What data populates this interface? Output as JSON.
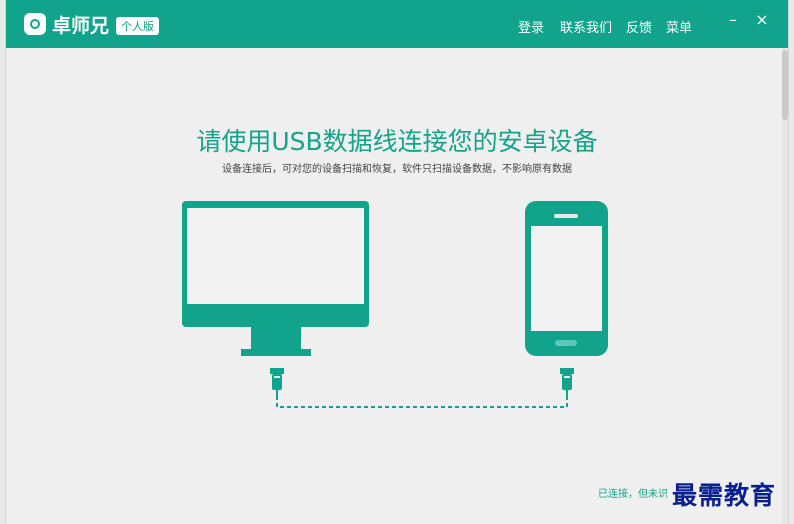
{
  "window": {
    "title": "卓师兄",
    "edition": "个人版",
    "menu": {
      "login": "登录",
      "contact": "联系我们",
      "feedback": "反馈",
      "menu": "菜单"
    },
    "controls": {
      "minimize": "–",
      "close": "×"
    }
  },
  "main": {
    "heading": "请使用USB数据线连接您的安卓设备",
    "subheading": "设备连接后，可对您的设备扫描和恢复，软件只扫描设备数据，不影响原有数据"
  },
  "status": {
    "text": "已连接，但未识"
  },
  "watermark": {
    "text": "最需教育"
  },
  "colors": {
    "accent": "#12a38c",
    "background": "#efefef",
    "watermark": "#0a1f8f"
  },
  "icons": [
    "app-logo-icon",
    "monitor-icon",
    "phone-icon",
    "usb-plug-icon",
    "dashed-cable-icon"
  ]
}
